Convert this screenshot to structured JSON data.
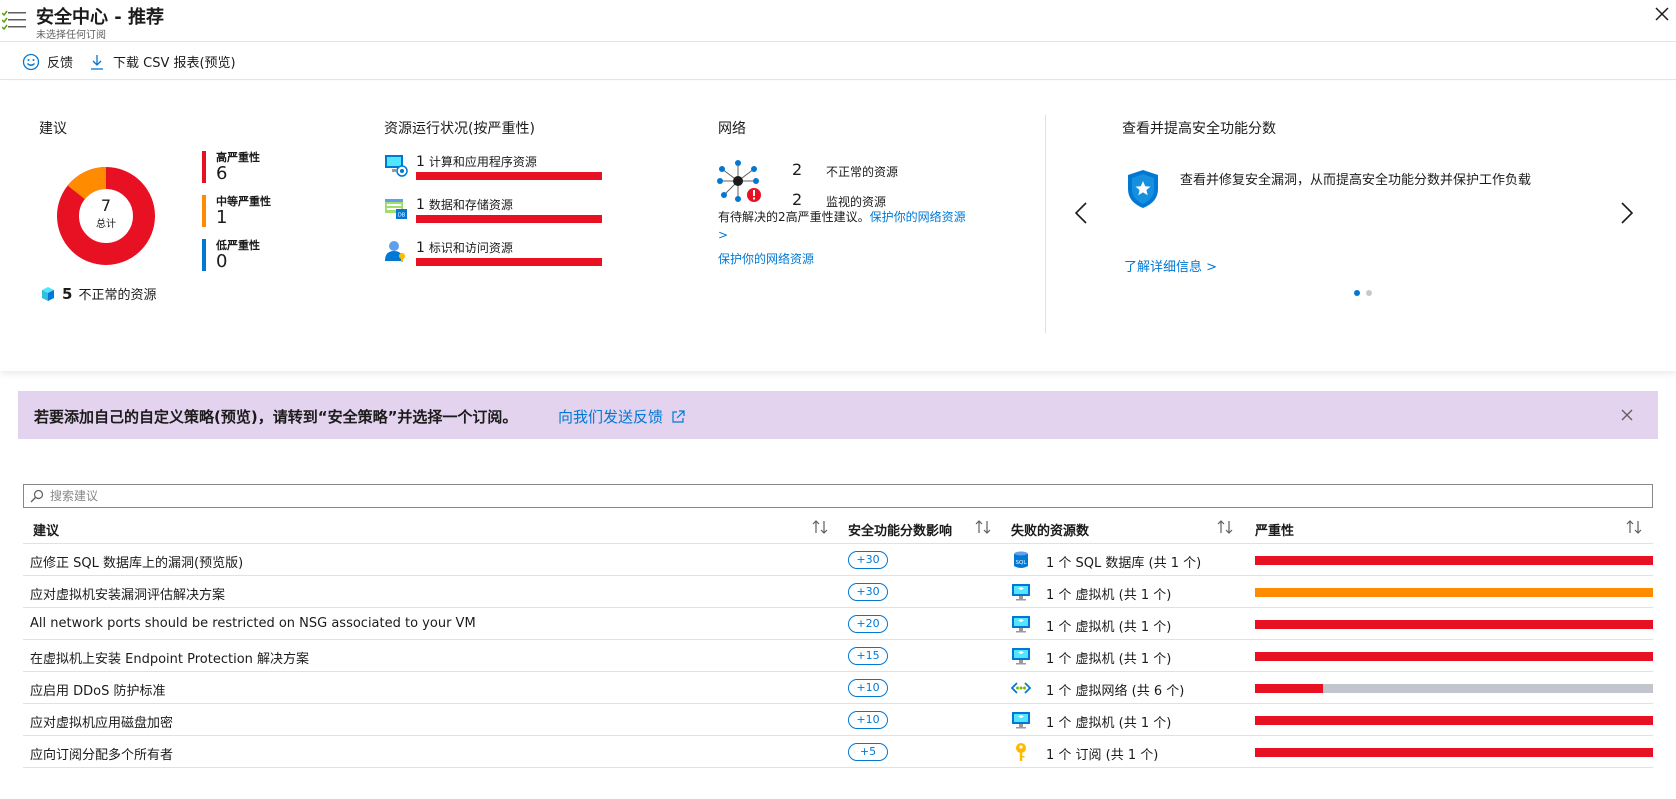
{
  "header": {
    "title": "安全中心 - 推荐",
    "subtitle": "未选择任何订阅"
  },
  "toolbar": {
    "feedback": "反馈",
    "download": "下载 CSV 报表(预览)"
  },
  "recommendations": {
    "title": "建议",
    "total_value": "7",
    "total_label": "总计",
    "high_label": "高严重性",
    "high_value": "6",
    "medium_label": "中等严重性",
    "medium_value": "1",
    "low_label": "低严重性",
    "low_value": "0",
    "unhealthy_count": "5",
    "unhealthy_label": "不正常的资源",
    "colors": {
      "high": "#e81123",
      "medium": "#ff8c00",
      "low": "#0078d4"
    }
  },
  "resource_health": {
    "title": "资源运行状况(按严重性)",
    "rows": [
      {
        "count": "1",
        "label": "计算和应用程序资源"
      },
      {
        "count": "1",
        "label": "数据和存储资源"
      },
      {
        "count": "1",
        "label": "标识和访问资源"
      }
    ]
  },
  "network": {
    "title": "网络",
    "unhealthy_count": "2",
    "unhealthy_label": "不正常的资源",
    "monitored_count": "2",
    "monitored_label": "监视的资源",
    "description": "有待解决的2高严重性建议。",
    "description_link": "保护你的网络资源 >",
    "link2": "保护你的网络资源"
  },
  "secure_score": {
    "title": "查看并提高安全功能分数",
    "text": "查看并修复安全漏洞，从而提高安全功能分数并保护工作负载",
    "learn_more": "了解详细信息 >"
  },
  "banner": {
    "text": "若要添加自己的自定义策略(预览)，请转到“安全策略”并选择一个订阅。",
    "link": "向我们发送反馈"
  },
  "search": {
    "placeholder": "搜索建议"
  },
  "table": {
    "headers": {
      "recommendation": "建议",
      "score_impact": "安全功能分数影响",
      "failed_resources": "失败的资源数",
      "severity": "严重性"
    },
    "rows": [
      {
        "name": "应修正 SQL 数据库上的漏洞(预览版)",
        "score": "+30",
        "resource": "1 个 SQL 数据库 (共 1 个)",
        "icon": "sql-database-icon",
        "severity": "high"
      },
      {
        "name": "应对虚拟机安装漏洞评估解决方案",
        "score": "+30",
        "resource": "1 个 虚拟机 (共 1 个)",
        "icon": "virtual-machine-icon",
        "severity": "medium"
      },
      {
        "name": "All network ports should be restricted on NSG associated to your VM",
        "score": "+20",
        "resource": "1 个 虚拟机 (共 1 个)",
        "icon": "virtual-machine-icon",
        "severity": "high"
      },
      {
        "name": "在虚拟机上安装 Endpoint Protection 解决方案",
        "score": "+15",
        "resource": "1 个 虚拟机 (共 1 个)",
        "icon": "virtual-machine-icon",
        "severity": "high"
      },
      {
        "name": "应启用 DDoS 防护标准",
        "score": "+10",
        "resource": "1 个 虚拟网络 (共 6 个)",
        "icon": "virtual-network-icon",
        "severity": "high-partial"
      },
      {
        "name": "应对虚拟机应用磁盘加密",
        "score": "+10",
        "resource": "1 个 虚拟机 (共 1 个)",
        "icon": "virtual-machine-icon",
        "severity": "high"
      },
      {
        "name": "应向订阅分配多个所有者",
        "score": "+5",
        "resource": "1 个 订阅 (共 1 个)",
        "icon": "key-icon",
        "severity": "high"
      }
    ]
  }
}
